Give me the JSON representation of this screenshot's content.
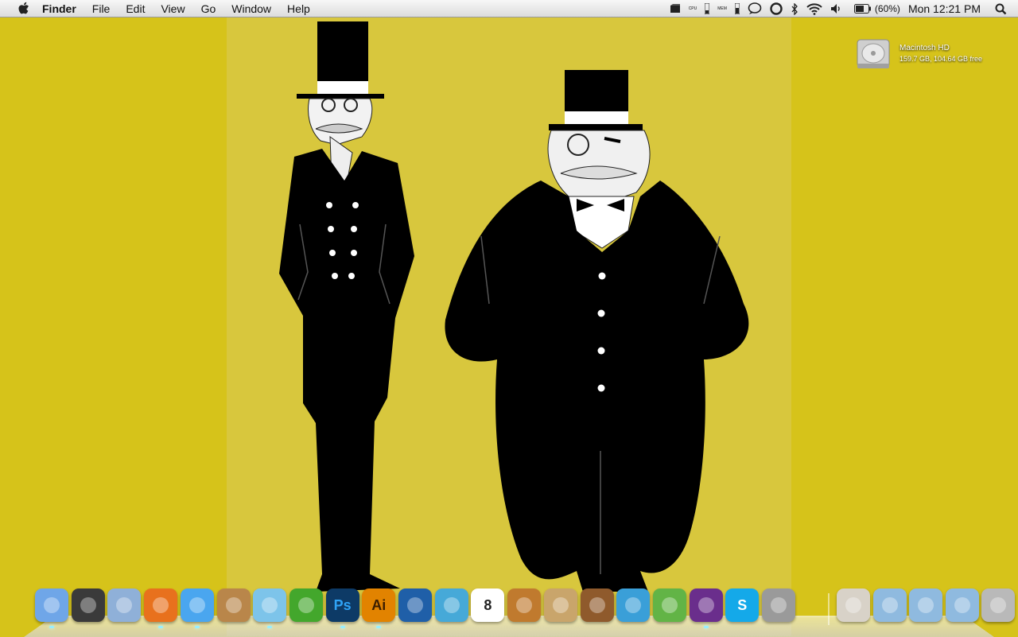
{
  "menubar": {
    "apple_icon": "apple-icon",
    "app_name": "Finder",
    "menus": [
      "File",
      "Edit",
      "View",
      "Go",
      "Window",
      "Help"
    ],
    "status": {
      "cpu_label": "CPU",
      "mem_label": "MEM",
      "battery_percent": "(60%)",
      "clock": "Mon 12:21 PM"
    }
  },
  "desktop": {
    "hd_name": "Macintosh HD",
    "hd_info": "159.7 GB, 104.64 GB free"
  },
  "dock": {
    "apps": [
      {
        "name": "finder",
        "icon": "finder-icon",
        "color": "#6fa6e8"
      },
      {
        "name": "dashboard",
        "icon": "dashboard-icon",
        "color": "#3a3a3a"
      },
      {
        "name": "mail",
        "icon": "mail-stamp-icon",
        "color": "#8fb0d8"
      },
      {
        "name": "firefox",
        "icon": "firefox-icon",
        "color": "#e8711d"
      },
      {
        "name": "ichat",
        "icon": "ichat-icon",
        "color": "#4aa6ef"
      },
      {
        "name": "address-book",
        "icon": "address-book-icon",
        "color": "#b9864a"
      },
      {
        "name": "itunes",
        "icon": "itunes-icon",
        "color": "#7dc4ea"
      },
      {
        "name": "leaf-app",
        "icon": "leaf-icon",
        "color": "#43a72c"
      },
      {
        "name": "photoshop",
        "icon": "photoshop-icon",
        "color": "#0d3a66",
        "label": "Ps",
        "fg": "#2fa3f6"
      },
      {
        "name": "illustrator",
        "icon": "illustrator-icon",
        "color": "#e28300",
        "label": "Ai",
        "fg": "#3b1d00"
      },
      {
        "name": "tasks",
        "icon": "checkbox-icon",
        "color": "#1f5fa8"
      },
      {
        "name": "alarm",
        "icon": "alarm-icon",
        "color": "#46a9d8"
      },
      {
        "name": "ical",
        "icon": "calendar-icon",
        "color": "#ffffff",
        "label": "8",
        "fg": "#222"
      },
      {
        "name": "garageband",
        "icon": "guitar-icon",
        "color": "#c07a2e"
      },
      {
        "name": "preview",
        "icon": "preview-icon",
        "color": "#c9a56b"
      },
      {
        "name": "iphoto",
        "icon": "iphoto-icon",
        "color": "#8f5a2c"
      },
      {
        "name": "wunderlist",
        "icon": "w-icon",
        "color": "#3a9fd8"
      },
      {
        "name": "linkinus",
        "icon": "share-icon",
        "color": "#62b446"
      },
      {
        "name": "front-row",
        "icon": "frame-icon",
        "color": "#6a2e8c"
      },
      {
        "name": "skype",
        "icon": "skype-icon",
        "color": "#14a9e9",
        "label": "S",
        "fg": "#fff"
      },
      {
        "name": "system-preferences",
        "icon": "gear-icon",
        "color": "#9a9a9a"
      },
      {
        "name": "home",
        "icon": "home-icon",
        "color": "#d8d2c8"
      },
      {
        "name": "applications",
        "icon": "applications-folder-icon",
        "color": "#8fbadf"
      },
      {
        "name": "documents",
        "icon": "documents-folder-icon",
        "color": "#8fbadf"
      },
      {
        "name": "downloads",
        "icon": "downloads-folder-icon",
        "color": "#8fbadf"
      },
      {
        "name": "trash",
        "icon": "trash-icon",
        "color": "#b9b9b9"
      }
    ],
    "running": [
      "finder",
      "firefox",
      "ichat",
      "itunes",
      "photoshop",
      "illustrator",
      "front-row"
    ]
  }
}
